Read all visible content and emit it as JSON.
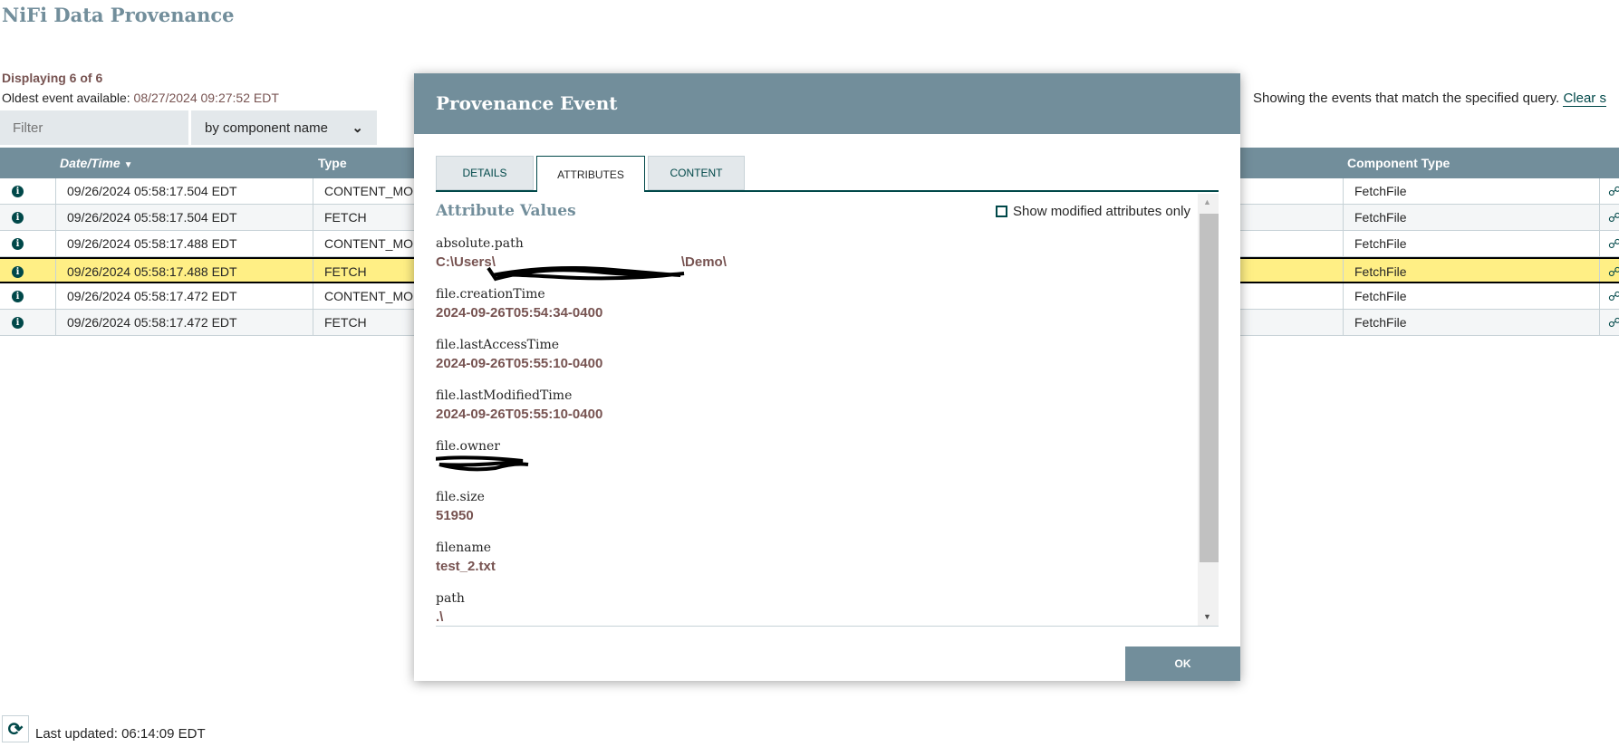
{
  "page": {
    "title": "NiFi Data Provenance",
    "displaying": "Displaying 6 of 6",
    "oldest_label": "Oldest event available: ",
    "oldest_value": "08/27/2024 09:27:52 EDT",
    "filter_placeholder": "Filter",
    "filter_by": "by component name",
    "showing": "Showing the events that match the specified query.",
    "clear": "Clear s",
    "last_updated": "Last updated: 06:14:09 EDT"
  },
  "table": {
    "headers": {
      "datetime": "Date/Time",
      "type": "Type",
      "component_type": "Component Type"
    },
    "rows": [
      {
        "datetime": "09/26/2024 05:58:17.504 EDT",
        "type": "CONTENT_MOD",
        "component_type": "FetchFile"
      },
      {
        "datetime": "09/26/2024 05:58:17.504 EDT",
        "type": "FETCH",
        "component_type": "FetchFile"
      },
      {
        "datetime": "09/26/2024 05:58:17.488 EDT",
        "type": "CONTENT_MOD",
        "component_type": "FetchFile"
      },
      {
        "datetime": "09/26/2024 05:58:17.488 EDT",
        "type": "FETCH",
        "component_type": "FetchFile",
        "selected": true
      },
      {
        "datetime": "09/26/2024 05:58:17.472 EDT",
        "type": "CONTENT_MOD",
        "component_type": "FetchFile"
      },
      {
        "datetime": "09/26/2024 05:58:17.472 EDT",
        "type": "FETCH",
        "component_type": "FetchFile"
      }
    ]
  },
  "dialog": {
    "title": "Provenance Event",
    "tabs": [
      "DETAILS",
      "ATTRIBUTES",
      "CONTENT"
    ],
    "active_tab": "ATTRIBUTES",
    "section_title": "Attribute Values",
    "modified_only": "Show modified attributes only",
    "ok": "OK",
    "attributes": [
      {
        "name": "absolute.path",
        "value_prefix": "C:\\Users\\",
        "value_suffix": "\\Demo\\",
        "redacted": true
      },
      {
        "name": "file.creationTime",
        "value": "2024-09-26T05:54:34-0400"
      },
      {
        "name": "file.lastAccessTime",
        "value": "2024-09-26T05:55:10-0400"
      },
      {
        "name": "file.lastModifiedTime",
        "value": "2024-09-26T05:55:10-0400"
      },
      {
        "name": "file.owner",
        "value": "",
        "redacted": true
      },
      {
        "name": "file.size",
        "value": "51950"
      },
      {
        "name": "filename",
        "value": "test_2.txt"
      },
      {
        "name": "path",
        "value": ".\\"
      }
    ]
  }
}
